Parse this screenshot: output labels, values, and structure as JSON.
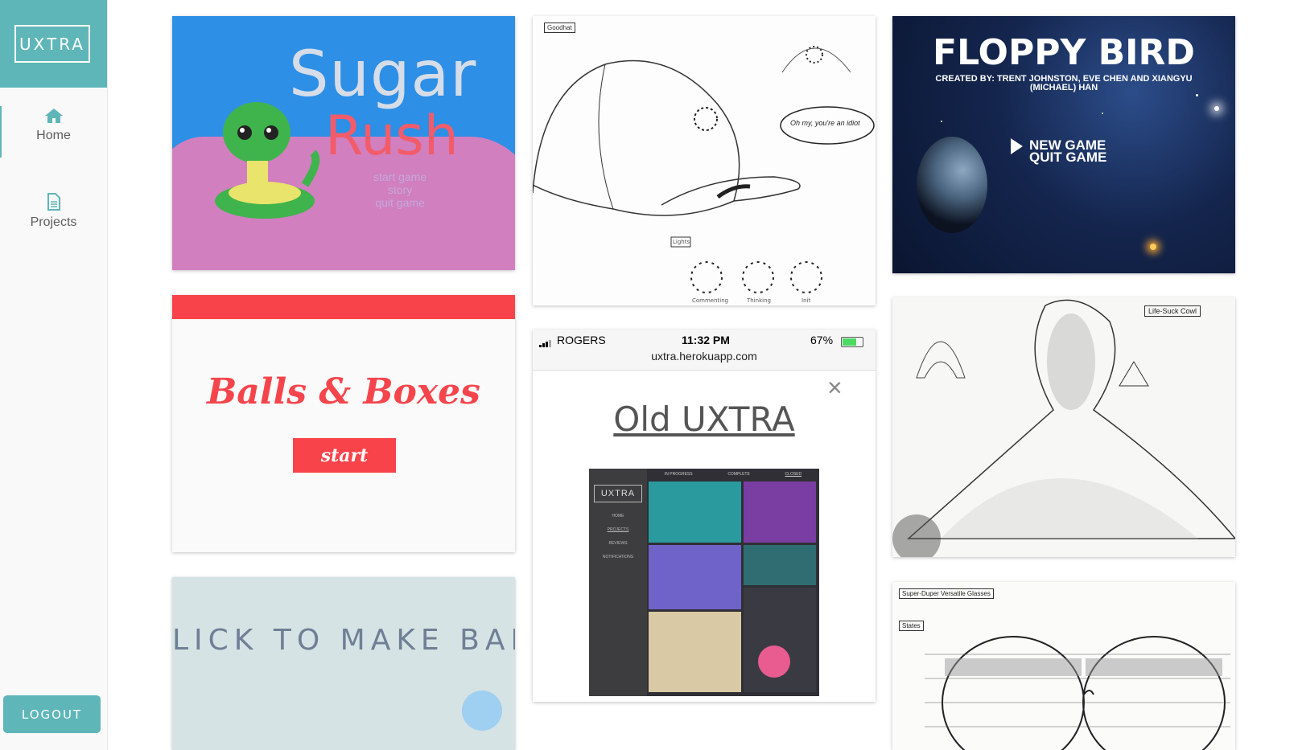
{
  "sidebar": {
    "logo": "UXTRA",
    "nav": [
      {
        "label": "Home",
        "icon": "home-icon"
      },
      {
        "label": "Projects",
        "icon": "document-icon"
      }
    ],
    "logout_label": "LOGOUT"
  },
  "colors": {
    "accent": "#5fb6b8",
    "balls_red": "#f8434a"
  },
  "cards": {
    "sugar_rush": {
      "title_line1": "Sugar",
      "title_line2": "Rush",
      "menu": [
        "start game",
        "story",
        "quit game"
      ]
    },
    "balls_boxes": {
      "title": "Balls & Boxes",
      "start": "start"
    },
    "click_balls": {
      "text": "LICK TO MAKE BALL"
    },
    "hat_sketch": {
      "label": "Goodhat",
      "bubble": "Oh my, you're an idiot",
      "lights_label": "Lights",
      "light_states": [
        "Commenting",
        "Thinking",
        "Init"
      ]
    },
    "old_uxtra": {
      "carrier": "ROGERS",
      "time": "11:32 PM",
      "battery": "67%",
      "url": "uxtra.herokuapp.com",
      "close": "×",
      "title": "Old UXTRA",
      "inner_logo": "UXTRA",
      "inner_nav": [
        "HOME",
        "PROJECTS",
        "REVIEWS",
        "NOTIFICATIONS"
      ],
      "inner_tabs": [
        "IN PROGRESS",
        "COMPLETE",
        "CLOSED"
      ]
    },
    "floppy_bird": {
      "title": "FLOPPY BIRD",
      "credit_line1": "CREATED BY: TRENT JOHNSTON, EVE CHEN AND XIANGYU",
      "credit_line2": "(MICHAEL) HAN",
      "menu": [
        "NEW GAME",
        "QUIT GAME"
      ]
    },
    "life_cowl": {
      "label": "Life-Suck Cowl"
    },
    "glasses": {
      "label": "Super-Duper Versatile Glasses",
      "states_label": "States"
    }
  }
}
